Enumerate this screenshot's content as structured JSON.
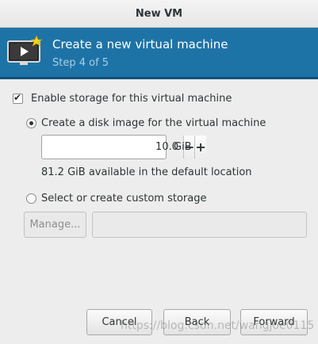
{
  "window": {
    "title": "New VM"
  },
  "header": {
    "title": "Create a new virtual machine",
    "step": "Step 4 of 5",
    "icon": "monitor-play-icon",
    "accent": "#1e73a6"
  },
  "storage": {
    "enable_label": "Enable storage for this virtual machine",
    "enable_checked": true,
    "disk_image_label": "Create a disk image for the virtual machine",
    "disk_image_selected": true,
    "size_value": "10.0",
    "size_unit": "GiB",
    "available_text": "81.2 GiB available in the default location",
    "custom_label": "Select or create custom storage",
    "manage_label": "Manage...",
    "custom_path_value": ""
  },
  "buttons": {
    "cancel": "Cancel",
    "back": "Back",
    "forward": "Forward"
  },
  "watermark": "https://blog.csdn.net/wangjoe0115"
}
